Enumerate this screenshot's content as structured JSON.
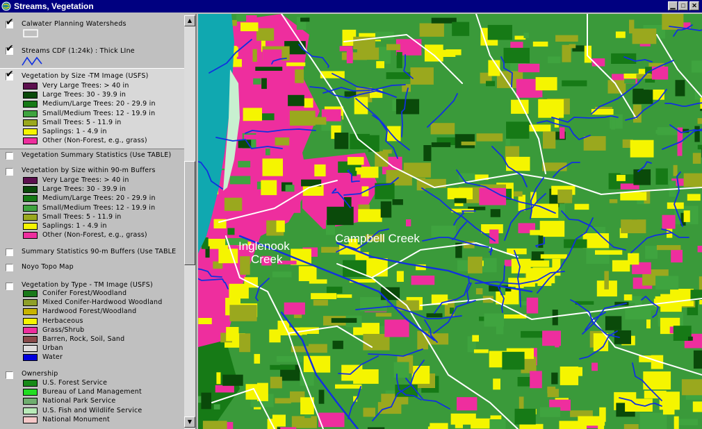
{
  "window": {
    "title": "Streams, Vegetation"
  },
  "toc": {
    "layers": [
      {
        "name": "Calwater Planning Watersheds",
        "checked": true
      },
      {
        "name": "Streams CDF (1:24k) : Thick LIne",
        "checked": true
      },
      {
        "name": "Vegetation by Size -TM Image (USFS)",
        "checked": true,
        "legend": [
          {
            "label": "Very Large Trees: > 40  in",
            "color": "#5c0f4e"
          },
          {
            "label": "Large Trees: 30 - 39.9 in",
            "color": "#0a4a0a"
          },
          {
            "label": "Medium/Large Trees: 20 - 29.9 in",
            "color": "#167a16"
          },
          {
            "label": "Small/Medium Trees: 12 - 19.9 in",
            "color": "#3fa43f"
          },
          {
            "label": "Small Trees: 5 - 11.9 in",
            "color": "#9aa81e"
          },
          {
            "label": "Saplings: 1 - 4.9 in",
            "color": "#f5f500"
          },
          {
            "label": "Other (Non-Forest, e.g., grass)",
            "color": "#ee2e9e"
          }
        ]
      },
      {
        "name": "Vegetation Summary Statistics (Use TABLE)",
        "checked": false
      },
      {
        "name": "Vegetation by Size within 90-m Buffers",
        "checked": false,
        "legend": [
          {
            "label": "Very Large Trees: > 40  in",
            "color": "#5c0f4e"
          },
          {
            "label": "Large Trees: 30 - 39.9 in",
            "color": "#0a4a0a"
          },
          {
            "label": "Medium/Large Trees: 20 - 29.9 in",
            "color": "#167a16"
          },
          {
            "label": "Small/Medium Trees: 12 - 19.9 in",
            "color": "#3fa43f"
          },
          {
            "label": "Small Trees: 5 - 11.9 in",
            "color": "#9aa81e"
          },
          {
            "label": "Saplings: 1 - 4.9 in",
            "color": "#f5f500"
          },
          {
            "label": "Other (Non-Forest, e.g., grass)",
            "color": "#ee2e9e"
          }
        ]
      },
      {
        "name": "Summary Statistics 90-m Buffers (Use TABLE",
        "checked": false
      },
      {
        "name": "Noyo Topo Map",
        "checked": false
      },
      {
        "name": "Vegetation by Type - TM Image (USFS)",
        "checked": false,
        "legend": [
          {
            "label": "Conifer Forest/Woodland",
            "color": "#1a7a1a"
          },
          {
            "label": "Mixed Conifer-Hardwood Woodland",
            "color": "#8fa02a"
          },
          {
            "label": "Hardwood Forest/Woodland",
            "color": "#c8b400"
          },
          {
            "label": "Herbaceous",
            "color": "#f5f500"
          },
          {
            "label": "Grass/Shrub",
            "color": "#ee2e9e"
          },
          {
            "label": "Barren, Rock, Soil, Sand",
            "color": "#8a4a4a"
          },
          {
            "label": "Urban",
            "color": "#e0dede"
          },
          {
            "label": "Water",
            "color": "#0000dd"
          }
        ]
      },
      {
        "name": "Ownership",
        "checked": false,
        "legend": [
          {
            "label": "U.S. Forest Service",
            "color": "#188a18"
          },
          {
            "label": "Bureau of Land Management",
            "color": "#22dd22"
          },
          {
            "label": "National Park Service",
            "color": "#6fae6f"
          },
          {
            "label": "U.S. Fish and Wildlife Service",
            "color": "#b8eab8"
          },
          {
            "label": "National Monument",
            "color": "#f5c8c8"
          }
        ]
      }
    ]
  },
  "map": {
    "labels": [
      {
        "text": "Inglenook",
        "id": "inglenook"
      },
      {
        "text": "Creek",
        "id": "inglenook-creek"
      },
      {
        "text": "Campbell Creek",
        "id": "campbell"
      }
    ],
    "colors": {
      "ocean": "#10a8b0",
      "beach": "#c8f0d0",
      "stream": "#1030e0",
      "watershed": "#ffffff"
    }
  }
}
